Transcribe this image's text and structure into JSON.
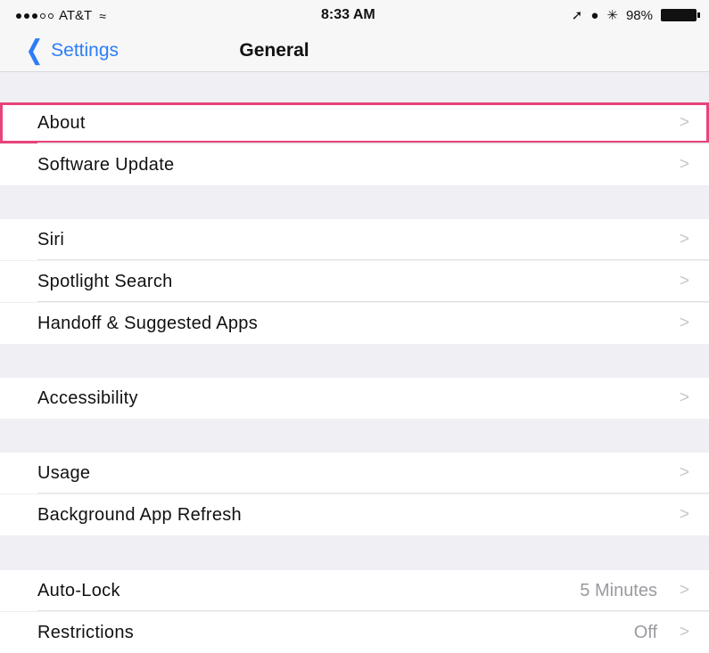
{
  "status_bar": {
    "carrier": "AT&T",
    "time": "8:33 AM",
    "battery": "98%"
  },
  "nav": {
    "back_label": "Settings",
    "title": "General"
  },
  "rows": [
    {
      "label": "About",
      "value": "",
      "chevron": ">"
    },
    {
      "label": "Software Update",
      "value": "",
      "chevron": ">"
    },
    {
      "label": "Siri",
      "value": "",
      "chevron": ">"
    },
    {
      "label": "Spotlight Search",
      "value": "",
      "chevron": ">"
    },
    {
      "label": "Handoff & Suggested Apps",
      "value": "",
      "chevron": ">"
    },
    {
      "label": "Accessibility",
      "value": "",
      "chevron": ">"
    },
    {
      "label": "Usage",
      "value": "",
      "chevron": ">"
    },
    {
      "label": "Background App Refresh",
      "value": "",
      "chevron": ">"
    },
    {
      "label": "Auto-Lock",
      "value": "5 Minutes",
      "chevron": ">"
    },
    {
      "label": "Restrictions",
      "value": "Off",
      "chevron": ">"
    }
  ],
  "colors": {
    "accent": "#2c7df7",
    "highlight_border": "#e8437a",
    "group_background": "#efeff4"
  }
}
